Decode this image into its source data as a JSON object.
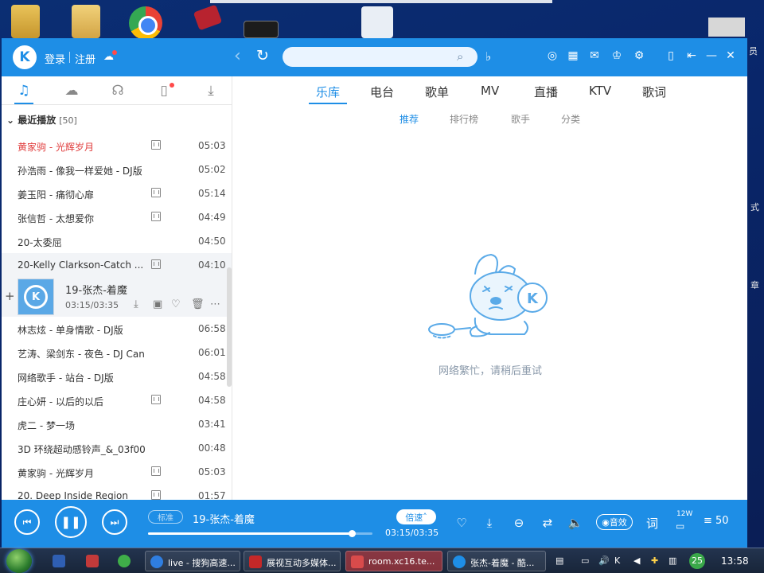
{
  "window": {
    "login": "登录",
    "register": "注册",
    "search": {
      "value": "",
      "placeholder": ""
    }
  },
  "left_panel": {
    "section_title": "最近播放",
    "section_count": "[50]",
    "songs": [
      {
        "title": "黄家驹 - 光辉岁月",
        "duration": "05:03",
        "mv": true,
        "red": true
      },
      {
        "title": "孙浩雨 - 像我一样爱她 - DJ版",
        "duration": "05:02",
        "mv": false
      },
      {
        "title": "姜玉阳 - 痛彻心扉",
        "duration": "05:14",
        "mv": true
      },
      {
        "title": "张信哲 - 太想爱你",
        "duration": "04:49",
        "mv": true
      },
      {
        "title": "20-太委屈",
        "duration": "04:50",
        "mv": false
      },
      {
        "title": "20-Kelly Clarkson-Catch ...",
        "duration": "04:10",
        "mv": true
      }
    ],
    "now_playing": {
      "title": "19-张杰-着魔",
      "time": "03:15/03:35"
    },
    "songs_after": [
      {
        "title": "林志炫 - 单身情歌 - DJ版",
        "duration": "06:58",
        "mv": false
      },
      {
        "title": "艺涛、梁剑东 - 夜色 - DJ Can...",
        "duration": "06:01",
        "mv": false
      },
      {
        "title": "网络歌手 - 站台 - DJ版",
        "duration": "04:58",
        "mv": false
      },
      {
        "title": "庄心妍 - 以后的以后",
        "duration": "04:58",
        "mv": true
      },
      {
        "title": "虎二 - 梦一场",
        "duration": "03:41",
        "mv": false
      },
      {
        "title": "3D 环绕超动感铃声_&_03f00f...",
        "duration": "00:48",
        "mv": false
      },
      {
        "title": "黄家驹 - 光辉岁月",
        "duration": "05:03",
        "mv": true
      },
      {
        "title": "20. Deep Inside Region",
        "duration": "01:57",
        "mv": true
      }
    ]
  },
  "main_tabs": [
    {
      "label": "乐库",
      "active": true
    },
    {
      "label": "电台"
    },
    {
      "label": "歌单"
    },
    {
      "label": "MV"
    },
    {
      "label": "直播"
    },
    {
      "label": "KTV"
    },
    {
      "label": "歌词"
    }
  ],
  "sub_tabs": [
    {
      "label": "推荐",
      "active": true
    },
    {
      "label": "排行榜"
    },
    {
      "label": "歌手"
    },
    {
      "label": "分类"
    }
  ],
  "content": {
    "error_message": "网络繁忙，请稍后重试"
  },
  "player": {
    "quality": "标准",
    "title": "19-张杰-着魔",
    "speed_label": "倍速",
    "time": "03:15/03:35",
    "progress": 0.907,
    "effect_label": "音效",
    "lyrics_label": "词",
    "listeners": "12W",
    "playlist_count": "50"
  },
  "taskbar": {
    "tasks": [
      {
        "label": "live - 搜狗高速..."
      },
      {
        "label": "展视互动多媒体..."
      },
      {
        "label": "room.xc16.te...",
        "active": true
      },
      {
        "label": "张杰-着魔 - 酷..."
      }
    ],
    "tray_badge": "25",
    "clock": "13:58"
  },
  "colors": {
    "brand": "#1e8ee6",
    "now_playing_red": "#e03b3b"
  }
}
